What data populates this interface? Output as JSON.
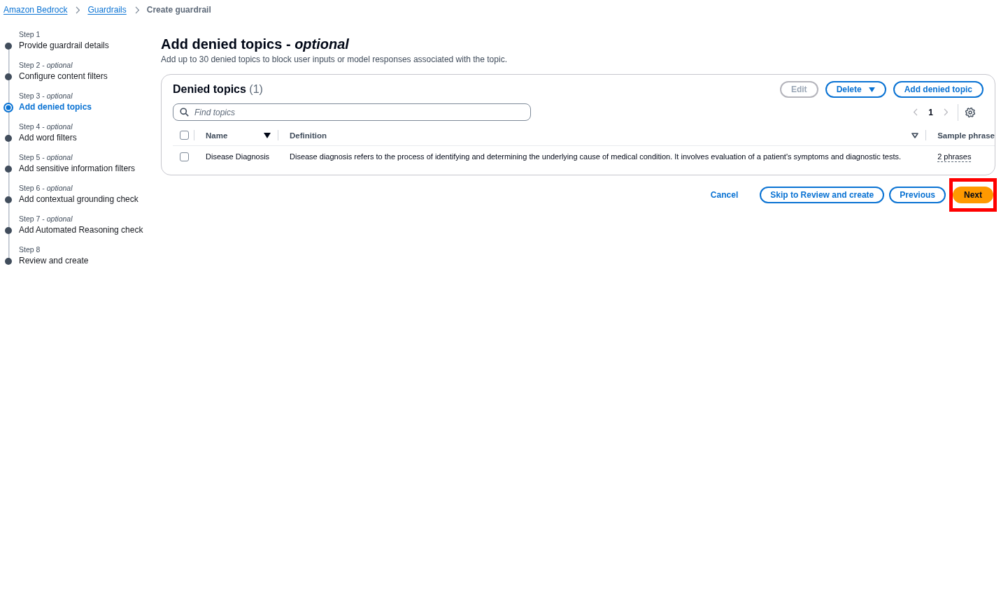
{
  "breadcrumbs": [
    {
      "label": "Amazon Bedrock",
      "kind": "link"
    },
    {
      "label": "Guardrails",
      "kind": "link"
    },
    {
      "label": "Create guardrail",
      "kind": "current"
    }
  ],
  "steps": [
    {
      "label": "Step 1",
      "title": "Provide guardrail details",
      "selected": false
    },
    {
      "label": "Step 2 - *optional*",
      "title": "Configure content filters",
      "selected": false
    },
    {
      "label": "Step 3 - *optional*",
      "title": "Add denied topics",
      "selected": true
    },
    {
      "label": "Step 4 - *optional*",
      "title": "Add word filters",
      "selected": false
    },
    {
      "label": "Step 5 - *optional*",
      "title": "Add sensitive information filters",
      "selected": false
    },
    {
      "label": "Step 6 - *optional*",
      "title": "Add contextual grounding check",
      "selected": false
    },
    {
      "label": "Step 7 - *optional*",
      "title": "Add Automated Reasoning check",
      "selected": false
    },
    {
      "label": "Step 8",
      "title": "Review and create",
      "selected": false
    }
  ],
  "page": {
    "title": "Add denied topics - *optional*",
    "description": "Add up to 30 denied topics to block user inputs or model responses associated with the topic."
  },
  "panel": {
    "title": "Denied topics",
    "count": "(1)",
    "buttons": [
      {
        "label": "Edit",
        "kind": "normal",
        "disabled": true
      },
      {
        "label": "Delete",
        "kind": "dropdown",
        "disabled": false
      },
      {
        "label": "Add denied topic",
        "kind": "normal",
        "disabled": false
      }
    ],
    "search": {
      "placeholder": "Find topics"
    },
    "pagination": {
      "page": "1",
      "previous_disabled": true,
      "next_disabled": true
    },
    "table": {
      "select_all": {
        "checked": false
      },
      "columns": [
        {
          "label": "Name",
          "kind": "sortable",
          "sorted": true
        },
        {
          "label": "Definition",
          "kind": "sortable",
          "sorted": false
        },
        {
          "label": "Sample phrase",
          "kind": "plain"
        }
      ],
      "rows": [
        {
          "selected": false,
          "name": "Disease Diagnosis",
          "definition": "Disease diagnosis refers to the process of identifying and determining the underlying cause of medical condition. It involves evaluation of a patient's symptoms and diagnostic tests.",
          "sample_phrases": "2 phrases"
        }
      ]
    }
  },
  "actions": [
    {
      "label": "Cancel",
      "kind": "link",
      "highlighted": false
    },
    {
      "label": "Skip to Review and create",
      "kind": "normal",
      "highlighted": false
    },
    {
      "label": "Previous",
      "kind": "normal",
      "highlighted": false
    },
    {
      "label": "Next",
      "kind": "primary",
      "highlighted": true
    }
  ]
}
